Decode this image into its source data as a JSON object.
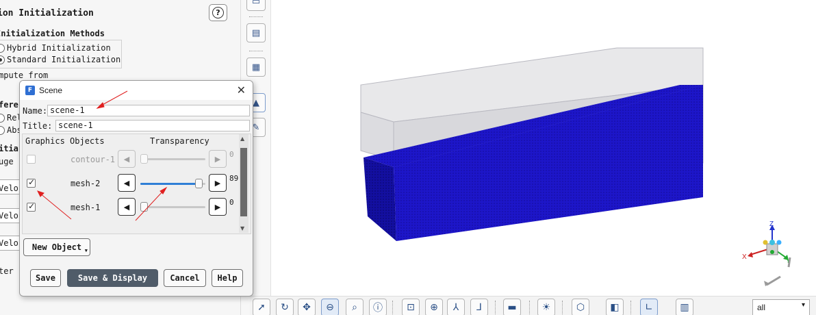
{
  "left_panel": {
    "title": "ion Initialization",
    "help_label": "?",
    "methods_heading": "Initialization Methods",
    "method_options": [
      "Hybrid  Initialization",
      "Standard Initialization"
    ],
    "compute_from": "mpute from",
    "partial_lines": [
      "fere",
      "Rel",
      "Abs",
      "itia",
      "uge",
      "Velo",
      "Velo",
      "Velo",
      "ter"
    ]
  },
  "scene_dialog": {
    "title": "Scene",
    "close_label": "✕",
    "name_label": "Name:",
    "name_value": "scene-1",
    "title_label": "Title:",
    "title_value": "scene-1",
    "col_graphics_objects": "Graphics Objects",
    "col_transparency": "Transparency",
    "objects": [
      {
        "name": "contour-1",
        "checked": false,
        "enabled": false,
        "transparency": 0
      },
      {
        "name": "mesh-2",
        "checked": true,
        "enabled": true,
        "transparency": 89
      },
      {
        "name": "mesh-1",
        "checked": true,
        "enabled": true,
        "transparency": 0
      }
    ],
    "new_object_label": "New Object",
    "buttons": {
      "save": "Save",
      "save_display": "Save & Display",
      "cancel": "Cancel",
      "help": "Help"
    }
  },
  "viewport": {
    "fluid_color": "#1a14c8",
    "triad_labels": {
      "x": "X",
      "y": "Y",
      "z": "Z"
    }
  },
  "bottom_toolbar": {
    "selection_value": "all"
  },
  "colors": {
    "accent": "#2f7fd6",
    "primary_button": "#505c69",
    "annotation_arrow": "#e02020"
  }
}
